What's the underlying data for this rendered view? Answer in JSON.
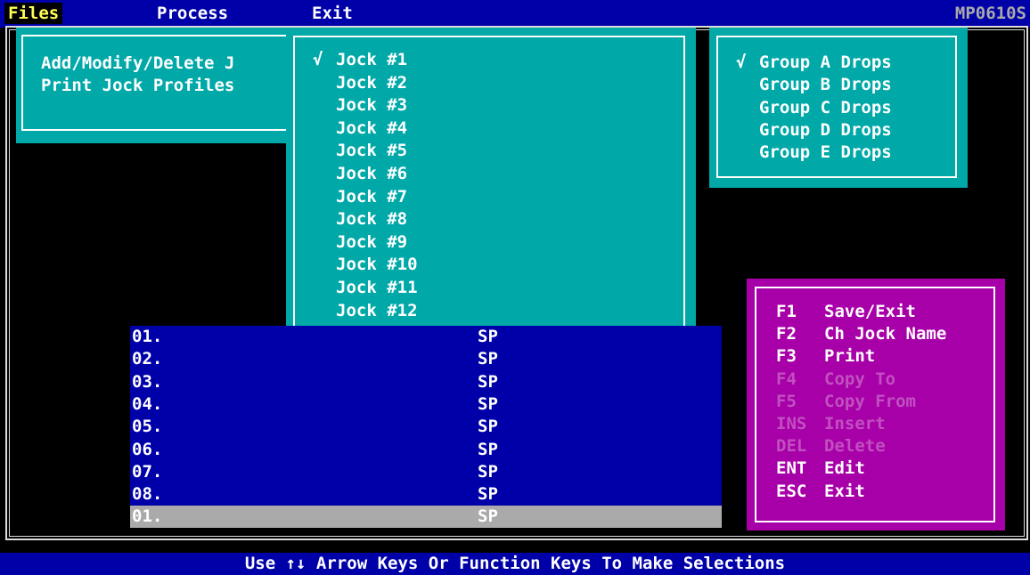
{
  "menubar": {
    "files": "Files",
    "process": "Process",
    "exit": "Exit",
    "program_code": "MP0610S"
  },
  "files_menu": {
    "items": [
      "Add/Modify/Delete J",
      "Print Jock Profiles"
    ]
  },
  "jock_menu": {
    "check_mark": "√",
    "items": [
      "Jock #1",
      "Jock #2",
      "Jock #3",
      "Jock #4",
      "Jock #5",
      "Jock #6",
      "Jock #7",
      "Jock #8",
      "Jock #9",
      "Jock #10",
      "Jock #11",
      "Jock #12"
    ],
    "checked_index": 0
  },
  "group_menu": {
    "check_mark": "√",
    "items": [
      "Group A Drops",
      "Group B Drops",
      "Group C Drops",
      "Group D Drops",
      "Group E Drops"
    ],
    "checked_index": 0
  },
  "list": {
    "rows": [
      {
        "num": "01.",
        "code": "SP"
      },
      {
        "num": "02.",
        "code": "SP"
      },
      {
        "num": "03.",
        "code": "SP"
      },
      {
        "num": "04.",
        "code": "SP"
      },
      {
        "num": "05.",
        "code": "SP"
      },
      {
        "num": "06.",
        "code": "SP"
      },
      {
        "num": "07.",
        "code": "SP"
      },
      {
        "num": "08.",
        "code": "SP"
      },
      {
        "num": "01.",
        "code": "SP"
      }
    ],
    "selected_index": 8
  },
  "function_keys": [
    {
      "key": "F1",
      "label": "Save/Exit",
      "enabled": true
    },
    {
      "key": "F2",
      "label": "Ch Jock Name",
      "enabled": true
    },
    {
      "key": "F3",
      "label": "Print",
      "enabled": true
    },
    {
      "key": "F4",
      "label": "Copy To",
      "enabled": false
    },
    {
      "key": "F5",
      "label": "Copy From",
      "enabled": false
    },
    {
      "key": "INS",
      "label": "Insert",
      "enabled": false
    },
    {
      "key": "DEL",
      "label": "Delete",
      "enabled": false
    },
    {
      "key": "ENT",
      "label": "Edit",
      "enabled": true
    },
    {
      "key": "ESC",
      "label": "Exit",
      "enabled": true
    }
  ],
  "status_bar": {
    "text": "Use ↑↓ Arrow Keys Or Function Keys To Make Selections"
  },
  "colors": {
    "menubar_bg": "#0000a8",
    "panel_teal": "#00a8a8",
    "fkey_panel": "#a800a8",
    "list_bg": "#0000a8",
    "selected_row": "#aaaaaa",
    "highlight_text": "#ffff55"
  }
}
